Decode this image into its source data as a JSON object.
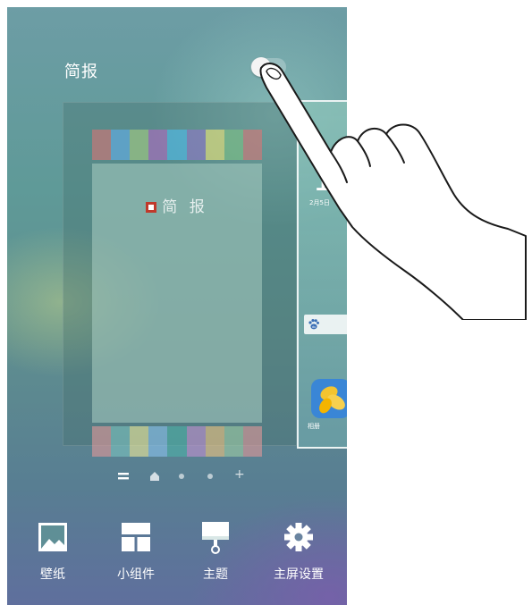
{
  "mode": {
    "title": "简报",
    "toggle_state": "on"
  },
  "briefing_preview": {
    "label": "简 报",
    "stripe_colors_top": [
      "#e57373",
      "#64b5f6",
      "#aed581",
      "#ba68c8",
      "#4fc3f7",
      "#9575cd",
      "#fff176",
      "#81c784",
      "#e57373"
    ],
    "stripe_colors_bottom": [
      "#ef9a9a",
      "#80cbc4",
      "#fff59d",
      "#90caf9",
      "#4db6ac",
      "#ce93d8",
      "#ffcc80",
      "#a5d6a7",
      "#ef9a9a"
    ]
  },
  "home_preview": {
    "clock_digit": "1",
    "date": "2月5日",
    "app_label": "相册"
  },
  "page_indicator": {
    "icons": [
      "menu-icon",
      "home-icon",
      "dot",
      "dot",
      "plus-icon"
    ],
    "add_symbol": "+"
  },
  "toolbar": {
    "wallpaper_label": "壁纸",
    "widgets_label": "小组件",
    "themes_label": "主题",
    "settings_label": "主屏设置"
  },
  "colors": {
    "accent": "#ffffff",
    "brief_logo": "#c0392b",
    "gallery_yellow": "#f4c430",
    "gallery_blue": "#3a86d6"
  }
}
